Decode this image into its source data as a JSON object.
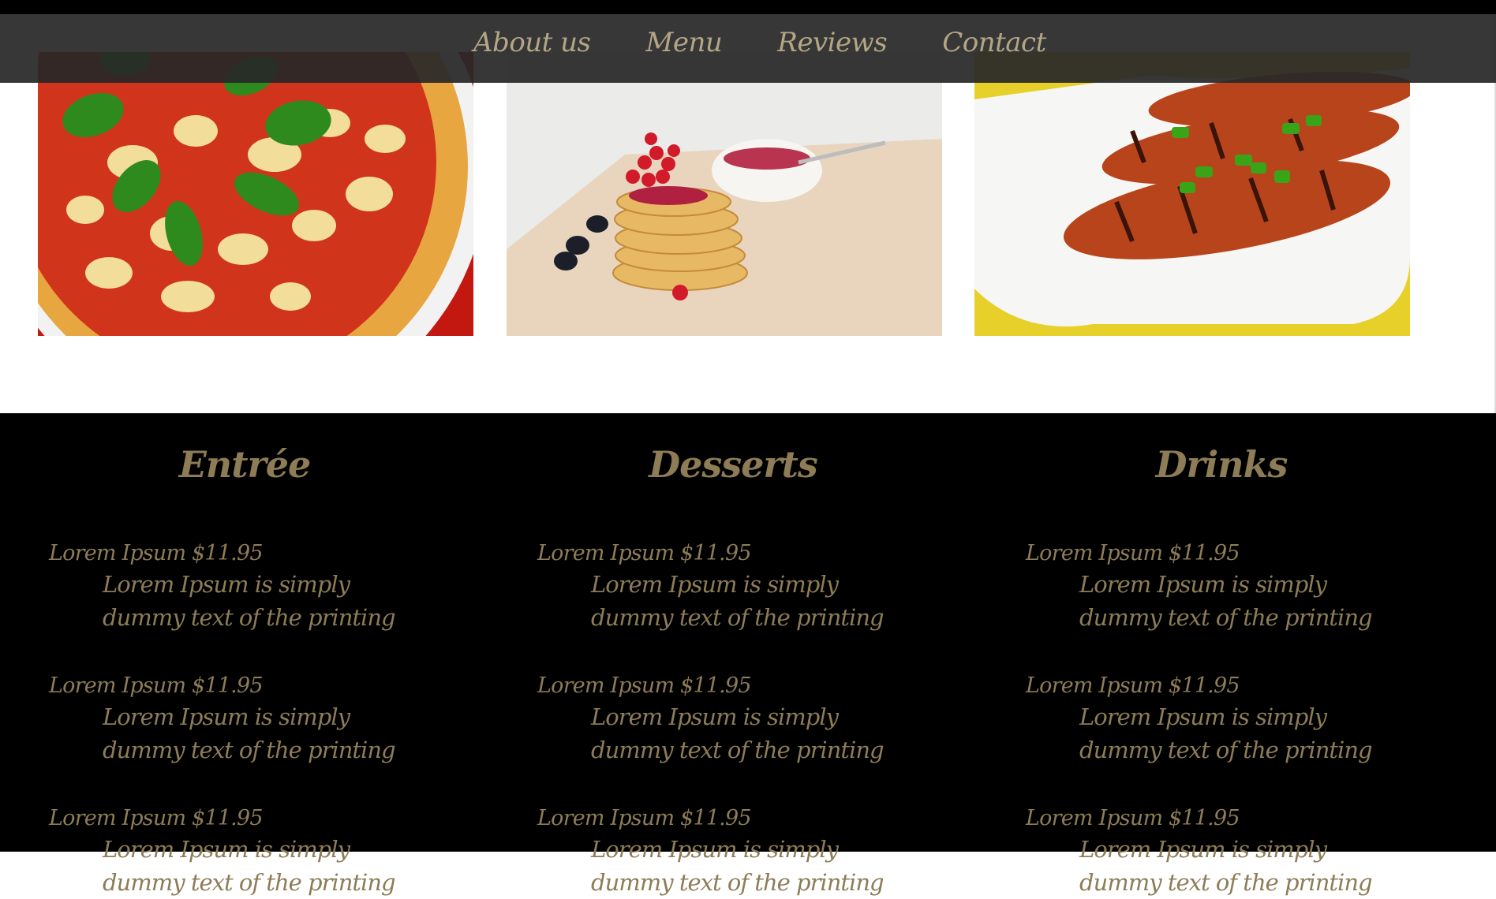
{
  "nav": {
    "items": [
      {
        "label": "About us"
      },
      {
        "label": "Menu"
      },
      {
        "label": "Reviews"
      },
      {
        "label": "Contact"
      }
    ]
  },
  "gallery": {
    "photos": [
      {
        "subject": "pizza"
      },
      {
        "subject": "pancakes"
      },
      {
        "subject": "grilled-chicken"
      }
    ]
  },
  "menu": {
    "columns": [
      {
        "title": "Entrée",
        "items": [
          {
            "name_price": "Lorem Ipsum $11.95",
            "description": "Lorem Ipsum is simply dummy text of the printing"
          },
          {
            "name_price": "Lorem Ipsum $11.95",
            "description": "Lorem Ipsum is simply dummy text of the printing"
          },
          {
            "name_price": "Lorem Ipsum $11.95",
            "description": "Lorem Ipsum is simply dummy text of the printing"
          }
        ]
      },
      {
        "title": "Desserts",
        "items": [
          {
            "name_price": "Lorem Ipsum $11.95",
            "description": "Lorem Ipsum is simply dummy text of the printing"
          },
          {
            "name_price": "Lorem Ipsum $11.95",
            "description": "Lorem Ipsum is simply dummy text of the printing"
          },
          {
            "name_price": "Lorem Ipsum $11.95",
            "description": "Lorem Ipsum is simply dummy text of the printing"
          }
        ]
      },
      {
        "title": "Drinks",
        "items": [
          {
            "name_price": "Lorem Ipsum $11.95",
            "description": "Lorem Ipsum is simply dummy text of the printing"
          },
          {
            "name_price": "Lorem Ipsum $11.95",
            "description": "Lorem Ipsum is simply dummy text of the printing"
          },
          {
            "name_price": "Lorem Ipsum $11.95",
            "description": "Lorem Ipsum is simply dummy text of the printing"
          }
        ]
      }
    ]
  },
  "colors": {
    "accent_gold": "#8d7c56",
    "nav_text": "#b3a685",
    "nav_background": "#282828",
    "menu_background": "#000000"
  }
}
